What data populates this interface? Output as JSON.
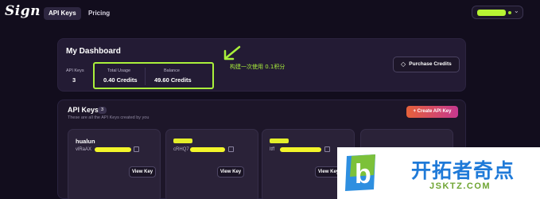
{
  "nav": {
    "logo": "Sign",
    "tabs": [
      {
        "label": "API Keys",
        "active": true
      },
      {
        "label": "Pricing",
        "active": false
      }
    ]
  },
  "dashboard": {
    "title": "My Dashboard",
    "stats": [
      {
        "label": "API Keys",
        "value": "3"
      },
      {
        "label": "Total Usage",
        "value": "0.40 Credits"
      },
      {
        "label": "Balance",
        "value": "49.60 Credits"
      }
    ],
    "annotation": "构建一次使用 0.1积分",
    "purchase_label": "Purchase Credits"
  },
  "api_keys": {
    "title": "API Keys",
    "count": "3",
    "subtitle": "These are all the API Keys created by you",
    "create_label": "+ Create API Key",
    "cards": [
      {
        "name": "hualun",
        "key_prefix": "vlRaAX",
        "button": "View Key"
      },
      {
        "name": "",
        "key_prefix": "cRHQ7",
        "button": "View Key"
      },
      {
        "name": "",
        "key_prefix": "ltff",
        "button": "View Key"
      }
    ]
  },
  "watermark": {
    "title": "开拓者奇点",
    "url": "JSKTZ.COM"
  },
  "colors": {
    "background": "#120d1d",
    "highlight": "#aaf03b",
    "accent_start": "#e5613a",
    "accent_end": "#c6388f"
  },
  "icons": [
    "chevron-down-icon",
    "gem-icon",
    "copy-icon",
    "cube-icon",
    "arrow-icon"
  ]
}
